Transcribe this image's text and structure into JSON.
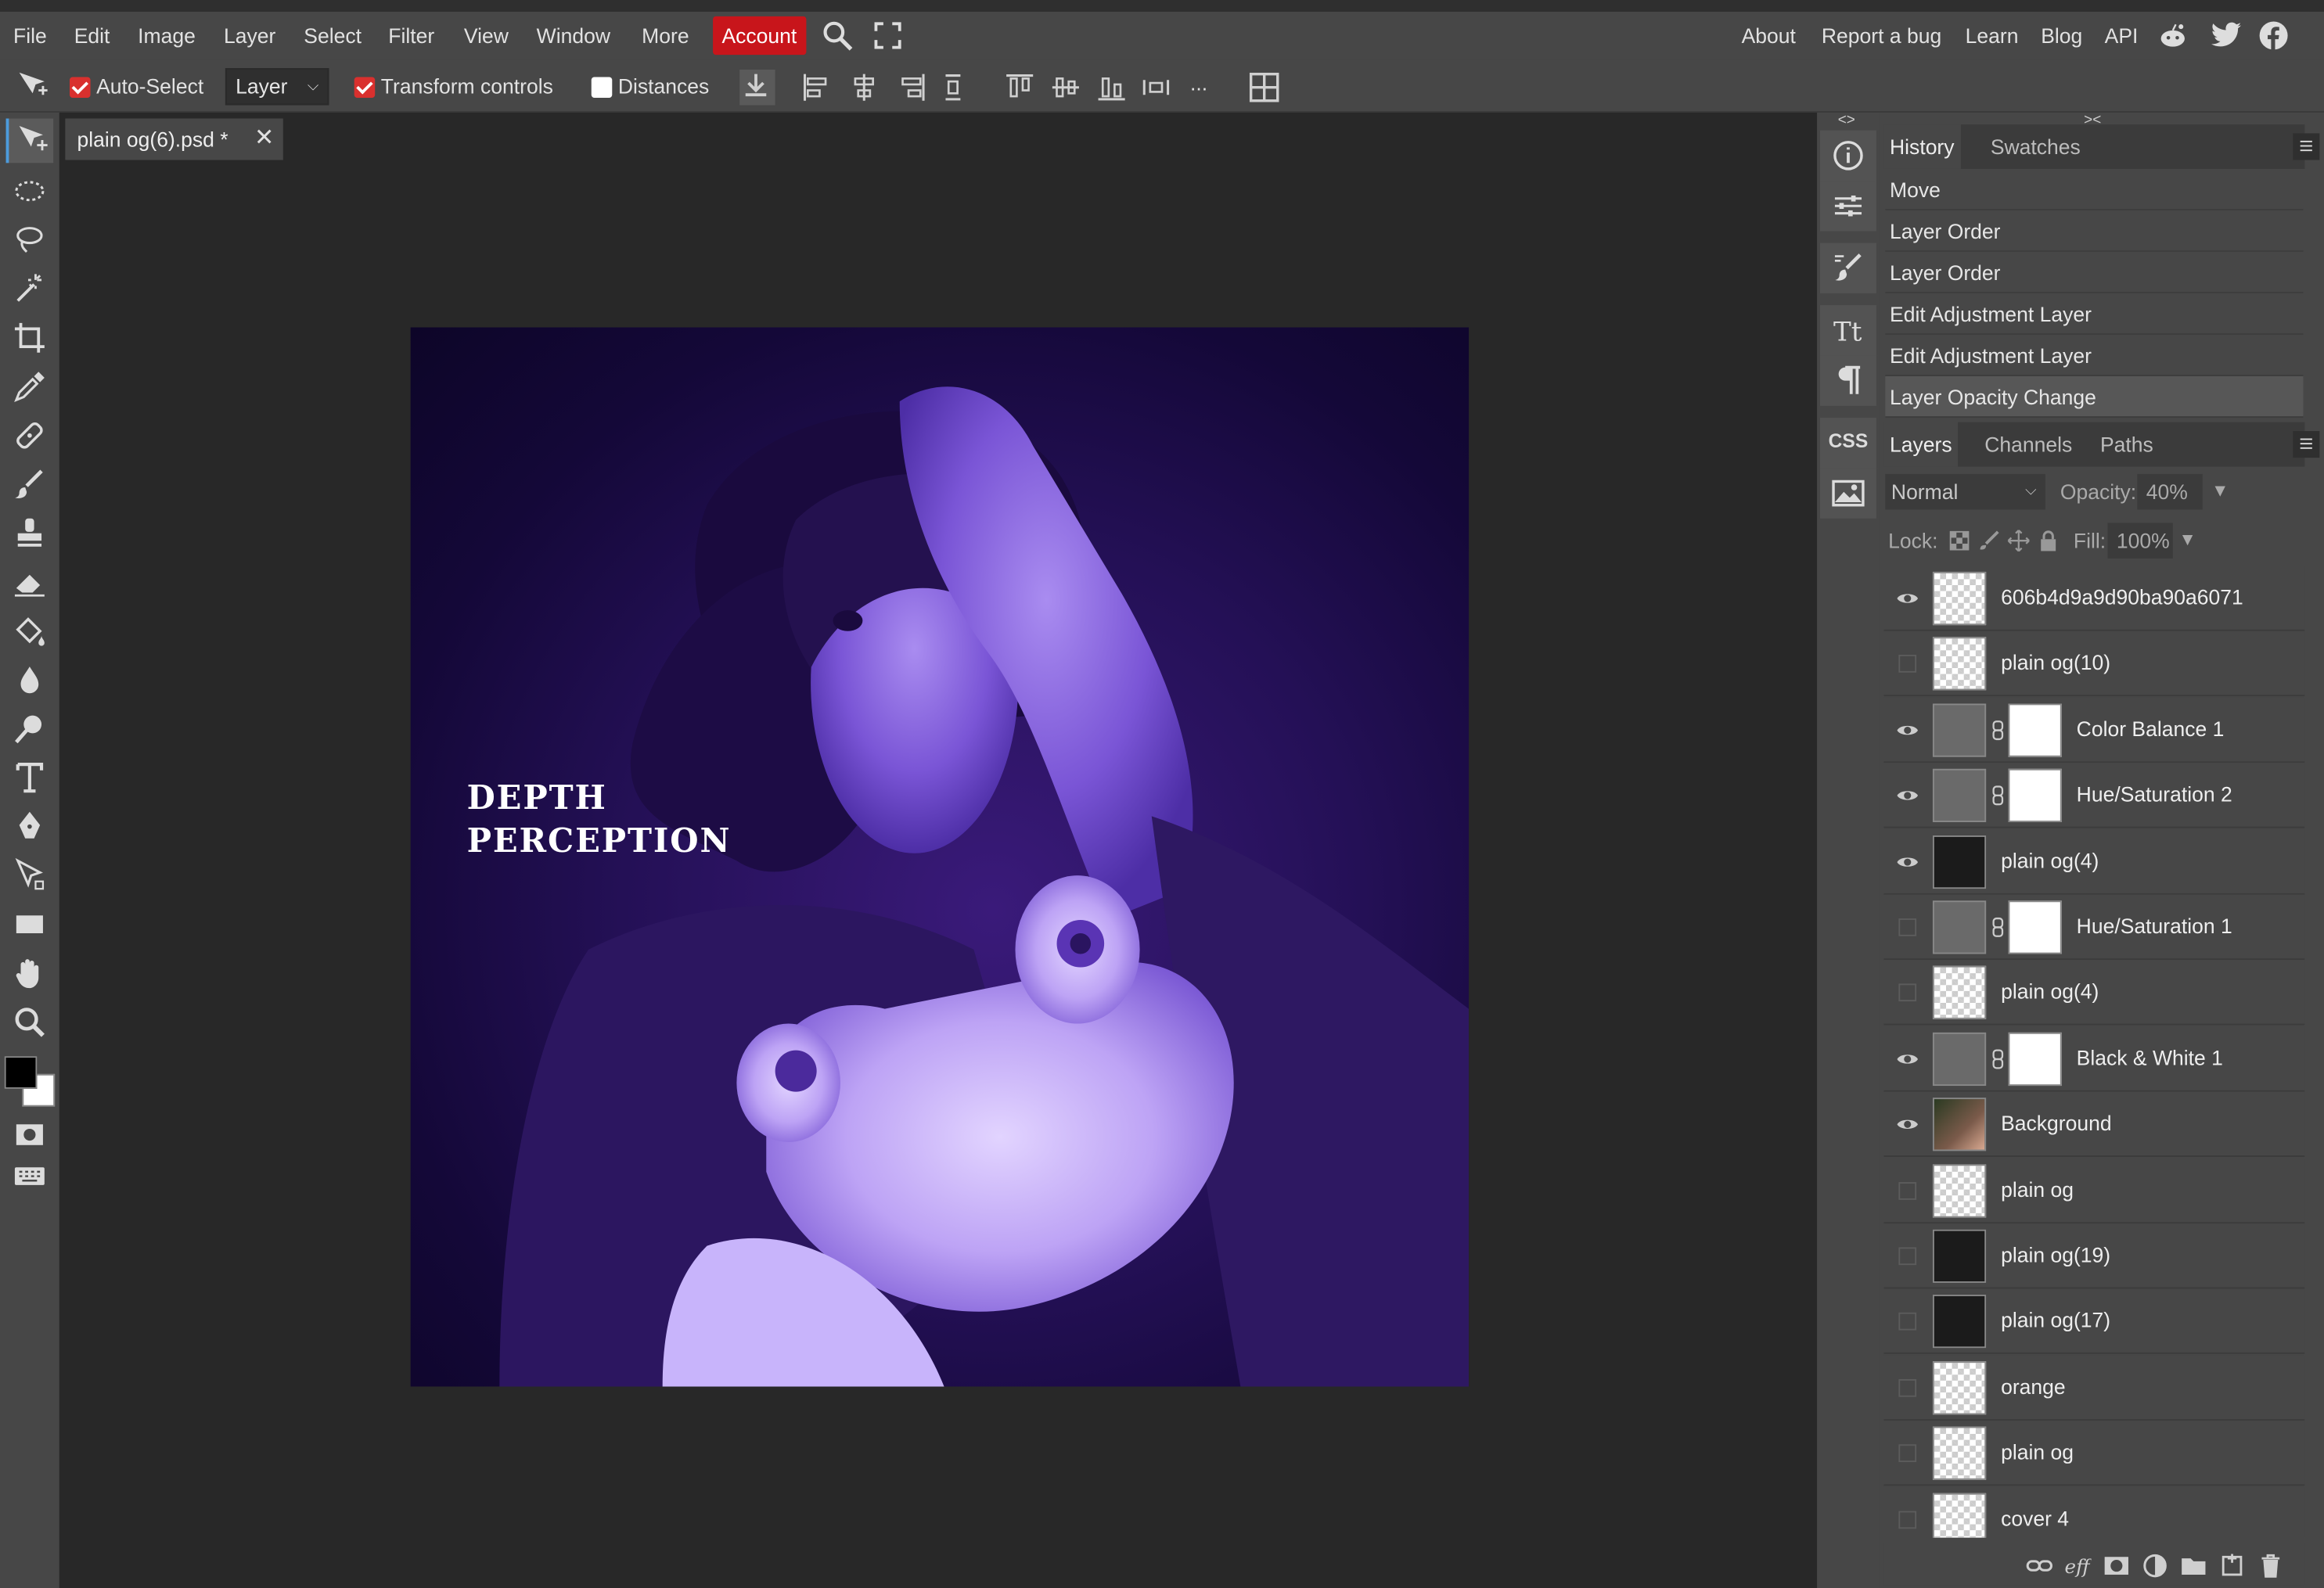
{
  "menu": {
    "items": [
      "File",
      "Edit",
      "Image",
      "Layer",
      "Select",
      "Filter",
      "View",
      "Window",
      "More"
    ],
    "account": "Account",
    "right": [
      "About",
      "Report a bug",
      "Learn",
      "Blog",
      "API"
    ]
  },
  "options": {
    "auto_select_label": "Auto-Select",
    "auto_select_checked": true,
    "auto_select_target": "Layer",
    "transform_label": "Transform controls",
    "transform_checked": true,
    "distances_label": "Distances",
    "distances_checked": false,
    "more": "..."
  },
  "document": {
    "tab_title": "plain og(6).psd *",
    "canvas_text_line1": "DEPTH",
    "canvas_text_line2": "PERCEPTION"
  },
  "sidepanel": {
    "css_label": "CSS"
  },
  "history": {
    "tabs": [
      "History",
      "Swatches"
    ],
    "items": [
      "Move",
      "Layer Order",
      "Layer Order",
      "Edit Adjustment Layer",
      "Edit Adjustment Layer",
      "Layer Opacity Change"
    ]
  },
  "layers_panel": {
    "tabs": [
      "Layers",
      "Channels",
      "Paths"
    ],
    "blend_mode": "Normal",
    "opacity_label": "Opacity:",
    "opacity_value": "40%",
    "lock_label": "Lock:",
    "fill_label": "Fill:",
    "fill_value": "100%",
    "layers": [
      {
        "name": "606b4d9a9d90ba90a6071",
        "visible": true,
        "kind": "smart"
      },
      {
        "name": "plain og(10)",
        "visible": false,
        "kind": "smart"
      },
      {
        "name": "Color Balance 1",
        "visible": true,
        "kind": "adjustment"
      },
      {
        "name": "Hue/Saturation 2",
        "visible": true,
        "kind": "adjustment"
      },
      {
        "name": "plain og(4)",
        "visible": true,
        "kind": "smart-dark"
      },
      {
        "name": "Hue/Saturation 1",
        "visible": false,
        "kind": "adjustment"
      },
      {
        "name": "plain og(4)",
        "visible": false,
        "kind": "smart"
      },
      {
        "name": "Black & White 1",
        "visible": true,
        "kind": "adjustment"
      },
      {
        "name": "Background",
        "visible": true,
        "kind": "photo"
      },
      {
        "name": "plain og",
        "visible": false,
        "kind": "smart"
      },
      {
        "name": "plain og(19)",
        "visible": false,
        "kind": "smart-dark"
      },
      {
        "name": "plain og(17)",
        "visible": false,
        "kind": "smart-dark"
      },
      {
        "name": "orange",
        "visible": false,
        "kind": "smart"
      },
      {
        "name": "plain og",
        "visible": false,
        "kind": "smart"
      },
      {
        "name": "cover 4",
        "visible": false,
        "kind": "smart"
      }
    ]
  },
  "colors": {
    "account_red": "#c8151b",
    "accent_blue": "#4c9bdc",
    "canvas_purple": "#241056"
  }
}
